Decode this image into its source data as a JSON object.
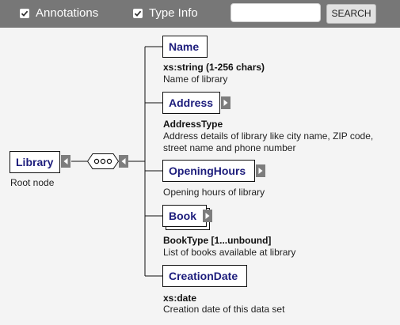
{
  "toolbar": {
    "annotations_label": "Annotations",
    "annotations_checked": true,
    "typeinfo_label": "Type Info",
    "typeinfo_checked": true,
    "search_value": "",
    "search_button_label": "SEARCH",
    "background_color": "#777777"
  },
  "diagram": {
    "root": {
      "name": "Library",
      "annotation": "Root node"
    },
    "compositor": "sequence",
    "children": [
      {
        "name": "Name",
        "type": "xs:string (1-256 chars)",
        "annotation": [
          "Name of library"
        ],
        "expandable": false,
        "repeating": false
      },
      {
        "name": "Address",
        "type": "AddressType",
        "annotation": [
          "Address details of library like city name, ZIP code,",
          "street name and phone number"
        ],
        "expandable": true,
        "repeating": false
      },
      {
        "name": "OpeningHours",
        "type": "",
        "annotation": [
          "Opening hours of library"
        ],
        "expandable": true,
        "repeating": false
      },
      {
        "name": "Book",
        "type": "BookType  [1...unbound]",
        "annotation": [
          "List of books available at library"
        ],
        "expandable": true,
        "repeating": true
      },
      {
        "name": "CreationDate",
        "type": "xs:date",
        "annotation": [
          "Creation date of this data set"
        ],
        "expandable": false,
        "repeating": false
      }
    ],
    "colors": {
      "element_text": "#1d1d7c",
      "border": "#111111",
      "expander": "#7d7d7d",
      "canvas": "#f4f4f4"
    }
  }
}
